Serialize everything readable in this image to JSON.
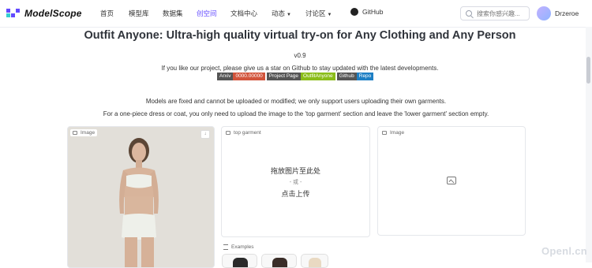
{
  "nav": {
    "brand": "ModelScope",
    "items": [
      {
        "label": "首页",
        "active": false,
        "caret": false
      },
      {
        "label": "模型库",
        "active": false,
        "caret": false
      },
      {
        "label": "数据集",
        "active": false,
        "caret": false
      },
      {
        "label": "创空间",
        "active": true,
        "caret": false
      },
      {
        "label": "文档中心",
        "active": false,
        "caret": false
      },
      {
        "label": "动态",
        "active": false,
        "caret": true
      },
      {
        "label": "讨论区",
        "active": false,
        "caret": true
      }
    ],
    "github_label": "GitHub",
    "search_placeholder": "搜索你感兴趣...",
    "username": "Drzeroe",
    "accent_color": "#624aff"
  },
  "page": {
    "title": "Outfit Anyone: Ultra-high quality virtual try-on for Any Clothing and Any Person",
    "version": "v0.9",
    "subtitle": "If you like our project, please give us a star on Github to stay updated with the latest developments.",
    "badges": [
      {
        "left": "Arxiv",
        "right": "0000.00000",
        "right_color": "#d2543b"
      },
      {
        "left": "Project Page",
        "right": "OutfitAnyone",
        "right_color": "#8bbd1a"
      },
      {
        "left": "Github",
        "right": "Repo",
        "right_color": "#1e7fc4"
      }
    ],
    "note_fixed": "Models are fixed and cannot be uploaded or modified; we only support users uploading their own garments.",
    "note_onepiece": "For a one-piece dress or coat, you only need to upload the image to the 'top garment' section and leave the 'lower garment' section empty."
  },
  "panels": {
    "model_label": "Image",
    "top_label": "top garment",
    "top_upload_line1": "拖放图片至此处",
    "top_upload_or": "- 或 -",
    "top_upload_line2": "点击上传",
    "output_label": "Image"
  },
  "examples": {
    "label": "Examples"
  },
  "watermark": "Openl.cn"
}
